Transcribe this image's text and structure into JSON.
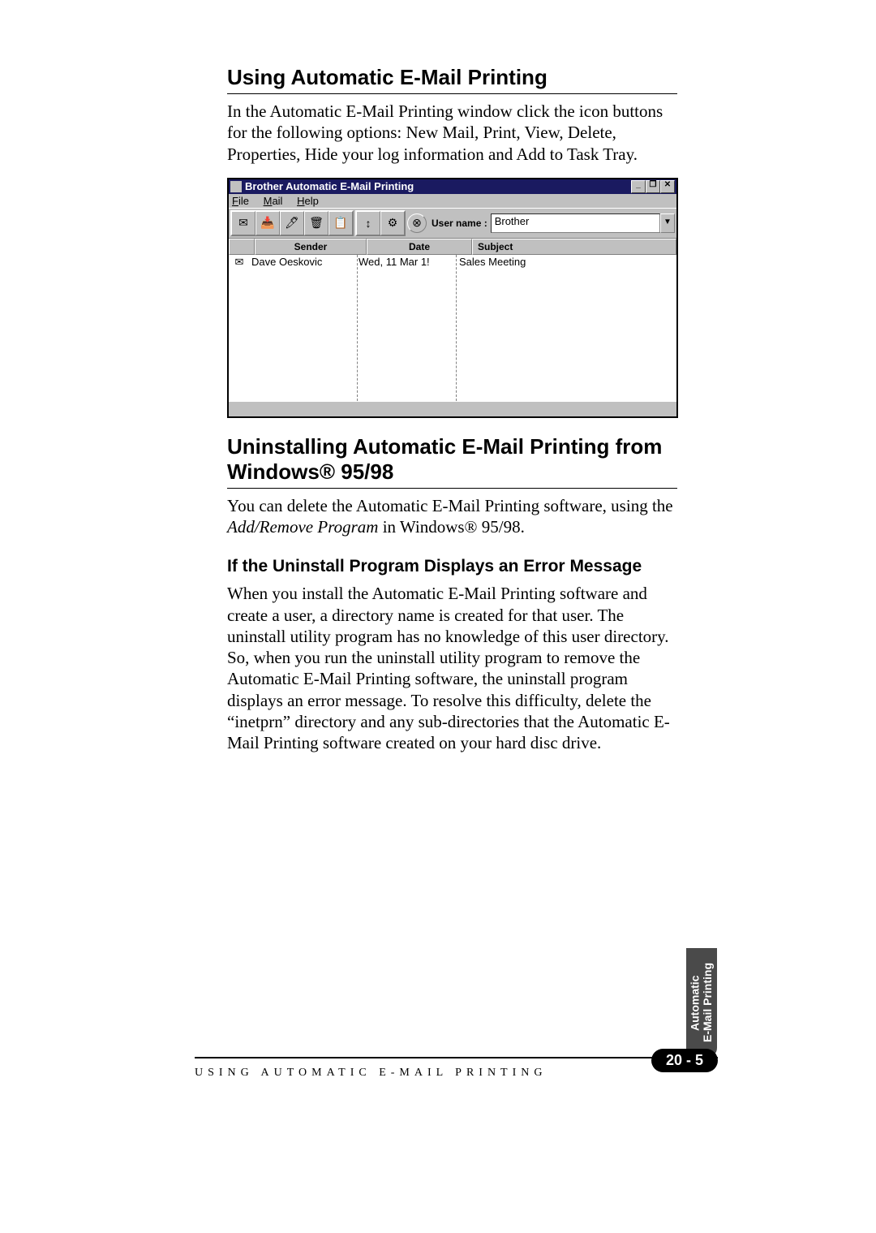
{
  "section1": {
    "heading": "Using Automatic E-Mail Printing",
    "para": "In the Automatic E-Mail Printing window click the icon buttons for the following options: New Mail, Print, View, Delete, Properties, Hide your log information and Add to Task Tray."
  },
  "window": {
    "title": "Brother Automatic E-Mail Printing",
    "menus": {
      "file": "File",
      "file_u": "F",
      "mail": "Mail",
      "mail_u": "M",
      "help": "Help",
      "help_u": "H"
    },
    "username_label": "User name :",
    "username_value": "Brother",
    "columns": {
      "sender": "Sender",
      "date": "Date",
      "subject": "Subject"
    },
    "row": {
      "icon": "✉",
      "sender": "Dave Oeskovic",
      "date": "Wed, 11 Mar 1!",
      "subject": "Sales Meeting"
    }
  },
  "section2": {
    "heading": "Uninstalling Automatic E-Mail Printing from Windows® 95/98",
    "para_a": "You can delete the Automatic E-Mail Printing software, using the ",
    "para_em": "Add/Remove Program",
    "para_b": " in Windows® 95/98."
  },
  "section3": {
    "heading": "If the Uninstall Program Displays an Error Message",
    "para": "When you install the Automatic E-Mail Printing software and create a user, a directory name is created for that user. The uninstall utility program has no knowledge of this user directory. So, when you run the uninstall utility program to remove the Automatic E-Mail Printing software, the uninstall  program displays an error message. To resolve this difficulty, delete the “inetprn” directory and any sub-directories that the Automatic E-Mail Printing software created on your hard disc drive."
  },
  "footer": {
    "running": "USING AUTOMATIC E-MAIL PRINTING",
    "pagenum": "20 - 5"
  },
  "sidetab": "Automatic\nE-Mail Printing",
  "titlebar_buttons": {
    "min": "_",
    "max": "❐",
    "close": "✕"
  },
  "dropdown_glyph": "▼",
  "toolbar_icons": [
    "✉",
    "📥",
    "🖊",
    "🗑",
    "📋",
    "↕",
    "⚙",
    "⊗"
  ]
}
